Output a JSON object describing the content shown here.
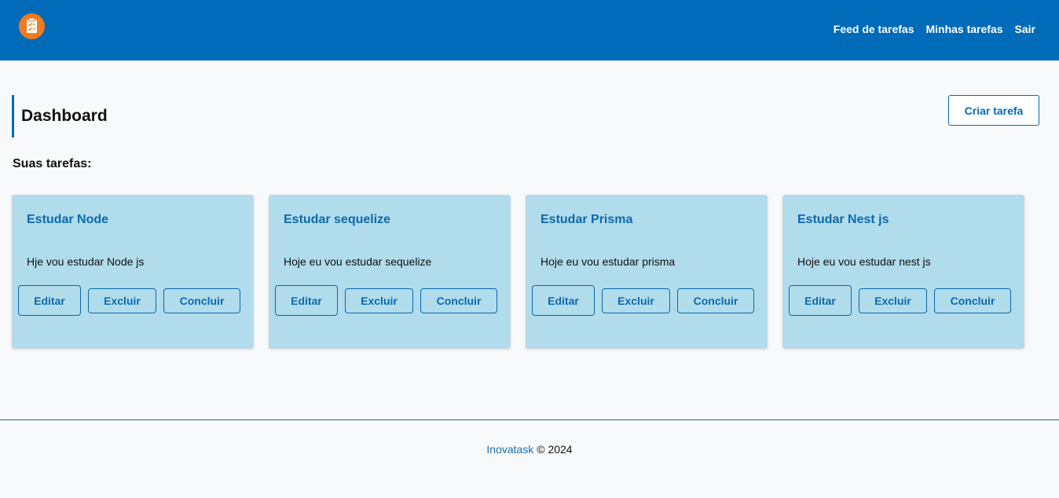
{
  "navbar": {
    "logo_icon": "clipboard-check-icon",
    "links": [
      "Feed de tarefas",
      "Minhas tarefas",
      "Sair"
    ]
  },
  "page": {
    "title": "Dashboard",
    "create_button": "Criar tarefa",
    "section_title": "Suas tarefas:"
  },
  "tasks": [
    {
      "title": "Estudar Node",
      "description": "Hje vou estudar Node js"
    },
    {
      "title": "Estudar sequelize",
      "description": "Hoje eu vou estudar sequelize"
    },
    {
      "title": "Estudar Prisma",
      "description": "Hoje eu vou estudar prisma"
    },
    {
      "title": "Estudar Nest js",
      "description": "Hoje eu vou estudar nest js"
    }
  ],
  "task_actions": {
    "edit": "Editar",
    "delete": "Excluir",
    "complete": "Concluir"
  },
  "footer": {
    "brand": "Inovatask",
    "copyright": "© 2024"
  },
  "colors": {
    "primary": "#006bb8",
    "logo": "#f47a20",
    "card_background": "#b0dcec",
    "page_background": "#f8f9fb"
  }
}
